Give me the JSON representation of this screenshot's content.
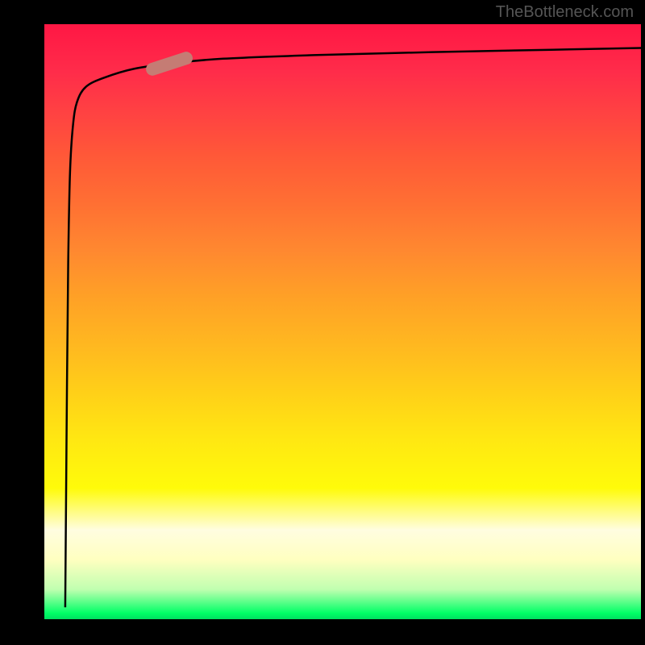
{
  "watermark": "TheBottleneck.com",
  "chart_data": {
    "type": "line",
    "title": "",
    "xlabel": "",
    "ylabel": "",
    "xlim": [
      0,
      100
    ],
    "ylim": [
      0,
      100
    ],
    "curve": {
      "x": [
        3.5,
        3.6,
        3.8,
        4.0,
        4.3,
        4.8,
        5.5,
        7.0,
        10,
        15,
        22,
        30,
        45,
        65,
        85,
        100
      ],
      "y": [
        2,
        15,
        40,
        60,
        75,
        83,
        87,
        89.5,
        91,
        92.5,
        93.5,
        94.2,
        94.8,
        95.3,
        95.7,
        96
      ]
    },
    "marker": {
      "x": 21,
      "y": 93.3,
      "label": ""
    },
    "gradient": {
      "top": "#ff1744",
      "mid_upper": "#ff8830",
      "mid": "#ffe812",
      "lower": "#ffffc0",
      "bottom": "#00ff66"
    }
  },
  "marker_style": {
    "color": "#c57c74"
  }
}
